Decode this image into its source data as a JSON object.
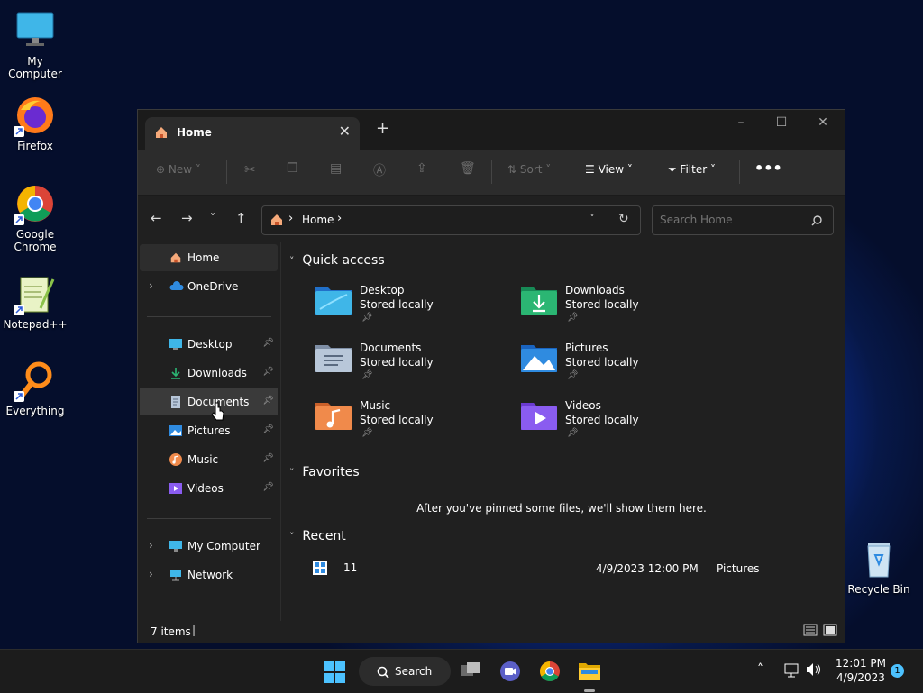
{
  "desktop": {
    "icons": [
      "My Computer",
      "Firefox",
      "Google Chrome",
      "Notepad++",
      "Everything",
      "Recycle Bin"
    ]
  },
  "window": {
    "tab_title": "Home",
    "toolbar": {
      "new": "New",
      "sort": "Sort",
      "view": "View",
      "filter": "Filter"
    },
    "address": "Home",
    "search_placeholder": "Search Home",
    "sidebar": {
      "home": "Home",
      "onedrive": "OneDrive",
      "pinned": [
        "Desktop",
        "Downloads",
        "Documents",
        "Pictures",
        "Music",
        "Videos"
      ],
      "my_computer": "My Computer",
      "network": "Network"
    },
    "quick_access": {
      "heading": "Quick access",
      "items": [
        {
          "name": "Desktop",
          "sub": "Stored locally"
        },
        {
          "name": "Downloads",
          "sub": "Stored locally"
        },
        {
          "name": "Documents",
          "sub": "Stored locally"
        },
        {
          "name": "Pictures",
          "sub": "Stored locally"
        },
        {
          "name": "Music",
          "sub": "Stored locally"
        },
        {
          "name": "Videos",
          "sub": "Stored locally"
        }
      ]
    },
    "favorites": {
      "heading": "Favorites",
      "empty_message": "After you've pinned some files, we'll show them here."
    },
    "recent": {
      "heading": "Recent",
      "items": [
        {
          "name": "11",
          "date": "4/9/2023 12:00 PM",
          "location": "Pictures"
        }
      ]
    },
    "status": "7 items"
  },
  "taskbar": {
    "search_label": "Search",
    "time": "12:01 PM",
    "date": "4/9/2023",
    "notification_count": "1"
  },
  "colors": {
    "accent": "#4cc2ff",
    "folder_blue": "#3a8ee6",
    "folder_green": "#2bb673",
    "folder_orange": "#f08a4b",
    "folder_purple": "#8a5cf0"
  }
}
